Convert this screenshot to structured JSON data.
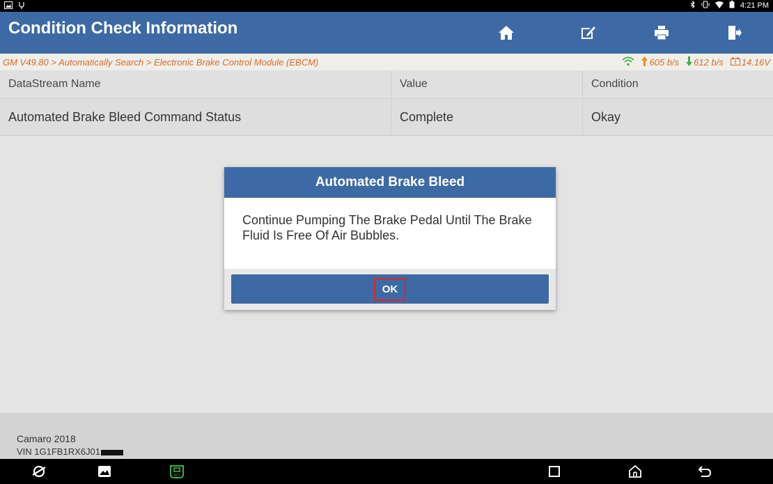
{
  "status_bar": {
    "time": "4:21 PM"
  },
  "header": {
    "title": "Condition Check Information"
  },
  "path_bar": {
    "path": "GM V49.80 > Automatically Search > Electronic Brake Control Module (EBCM)",
    "upload_rate": "605 b/s",
    "download_rate": "612 b/s",
    "voltage": "14.16V"
  },
  "table": {
    "columns": [
      "DataStream Name",
      "Value",
      "Condition"
    ],
    "rows": [
      {
        "name": "Automated Brake Bleed Command Status",
        "value": "Complete",
        "condition": "Okay"
      }
    ]
  },
  "dialog": {
    "title": "Automated Brake Bleed",
    "message": "Continue Pumping The Brake Pedal Until The Brake Fluid Is Free Of Air Bubbles.",
    "ok_label": "OK"
  },
  "footer": {
    "vehicle": "Camaro 2018",
    "vin": "VIN 1G1FB1RX6J01"
  },
  "colors": {
    "header_blue": "#3d6aa4",
    "path_orange": "#d96a2a",
    "highlight_red": "#d9262b"
  }
}
